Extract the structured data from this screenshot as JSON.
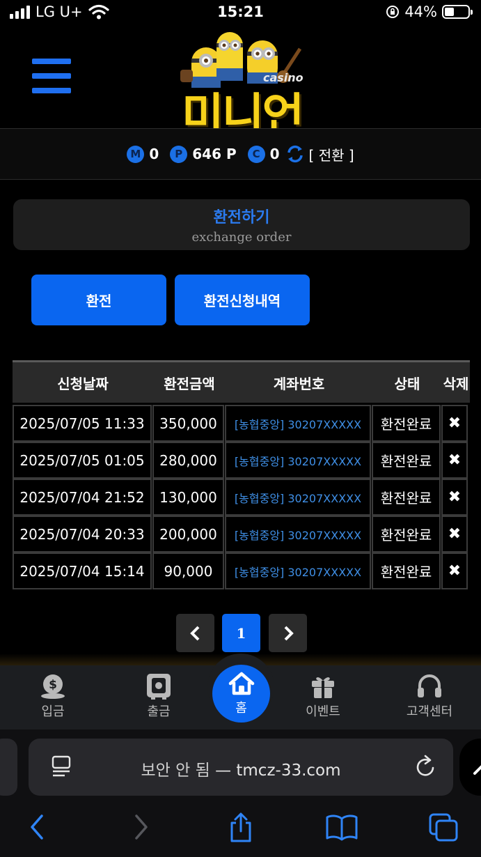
{
  "status_bar": {
    "carrier": "LG U+",
    "time": "15:21",
    "battery": "44%"
  },
  "header": {
    "logo_text": "미니언",
    "logo_sub": "casino"
  },
  "points": {
    "money_badge": "M",
    "money_value": "0",
    "point_badge": "P",
    "point_value": "646 P",
    "coin_badge": "C",
    "coin_value": "0",
    "switch_label": "[ 전환 ]"
  },
  "page": {
    "title": "환전하기",
    "subtitle": "exchange order"
  },
  "buttons": {
    "exchange": "환전",
    "history": "환전신청내역"
  },
  "table": {
    "headers": [
      "신청날짜",
      "환전금액",
      "계좌번호",
      "상태",
      "삭제"
    ],
    "rows": [
      {
        "date": "2025/07/05 11:33",
        "amount": "350,000",
        "account": "[농협중앙] 30207XXXXX",
        "status": "환전완료",
        "delete": "✖"
      },
      {
        "date": "2025/07/05 01:05",
        "amount": "280,000",
        "account": "[농협중앙] 30207XXXXX",
        "status": "환전완료",
        "delete": "✖"
      },
      {
        "date": "2025/07/04 21:52",
        "amount": "130,000",
        "account": "[농협중앙] 30207XXXXX",
        "status": "환전완료",
        "delete": "✖"
      },
      {
        "date": "2025/07/04 20:33",
        "amount": "200,000",
        "account": "[농협중앙] 30207XXXXX",
        "status": "환전완료",
        "delete": "✖"
      },
      {
        "date": "2025/07/04 15:14",
        "amount": "90,000",
        "account": "[농협중앙] 30207XXXXX",
        "status": "환전완료",
        "delete": "✖"
      }
    ]
  },
  "pagination": {
    "current": "1"
  },
  "bottom_nav": {
    "deposit": "입금",
    "withdraw": "출금",
    "home": "홈",
    "event": "이벤트",
    "support": "고객센터"
  },
  "browser": {
    "security": "보안 안 됨",
    "separator": "—",
    "domain": "tmcz-33.com"
  },
  "colors": {
    "accent": "#0a66f0",
    "logo_yellow": "#f7d21a",
    "account_link": "#3f8fe6"
  }
}
